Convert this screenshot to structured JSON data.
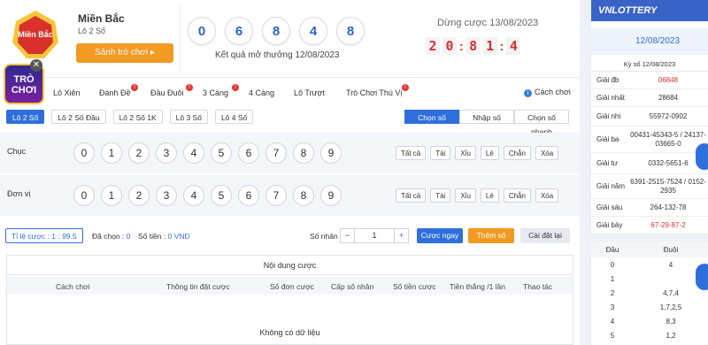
{
  "header": {
    "region_badge": "Miền Bắc",
    "region_title": "Miền Bắc",
    "region_sub": "Lô 2 Số",
    "lobby_button": "Sảnh trò chơi ▸",
    "result_balls": [
      "0",
      "6",
      "8",
      "4",
      "8"
    ],
    "result_caption": "Kết quả mở thưởng 12/08/2023",
    "stop_label": "Dừng cược 13/08/2023",
    "timer": [
      "2",
      "0",
      "8",
      "1",
      "4"
    ],
    "game_badge": "TRÒ CHƠI",
    "close": "✕"
  },
  "tabs": [
    {
      "label": "Lô Xiên",
      "hot": false
    },
    {
      "label": "Đánh Đề",
      "hot": true
    },
    {
      "label": "Đầu Đuôi",
      "hot": true
    },
    {
      "label": "3 Càng",
      "hot": true
    },
    {
      "label": "4 Càng",
      "hot": false
    },
    {
      "label": "Lô Trượt",
      "hot": false
    },
    {
      "label": "Trò Chơi Thú Vị",
      "hot": true
    }
  ],
  "how_to_play": "Cách chơi",
  "subtabs": [
    "Lô 2 Số",
    "Lô 2 Số Đầu",
    "Lô 2 Số 1K",
    "Lô 3 Số",
    "Lô 4 Số"
  ],
  "modes": [
    "Chọn số",
    "Nhập số",
    "Chọn số nhanh"
  ],
  "rows": [
    {
      "label": "Chục"
    },
    {
      "label": "Đơn vị"
    }
  ],
  "numbers": [
    "0",
    "1",
    "2",
    "3",
    "4",
    "5",
    "6",
    "7",
    "8",
    "9"
  ],
  "ops": [
    "Tất cả",
    "Tài",
    "Xỉu",
    "Lẻ",
    "Chẵn",
    "Xóa"
  ],
  "bet": {
    "rate": "Tỉ lệ cược : 1 : 99.5",
    "selected_label": "Đã chọn :",
    "selected_value": "0",
    "money_label": "Số tiền :",
    "money_value": "0 VND",
    "multiplier_label": "Số nhân :",
    "multiplier_value": "1",
    "minus": "−",
    "plus": "+",
    "bet_now": "Cược ngay",
    "add_number": "Thêm số",
    "reset": "Cài đặt lại"
  },
  "table": {
    "title": "Nội dung cược",
    "headers": [
      "Cách chơi",
      "Thông tin đặt cược",
      "Số đơn cược",
      "Cấp số nhân",
      "Số tiền cược",
      "Tiền thắng /1 lần",
      "Thao tác"
    ],
    "empty": "Không có dữ liệu"
  },
  "sidebar": {
    "logo": "VNLOTTERY",
    "date": "12/08/2023",
    "ky_so": "Kỳ số 12/08/2023",
    "prizes": [
      {
        "name": "Giải đb",
        "value": "06848"
      },
      {
        "name": "Giải nhất",
        "value": "28684"
      },
      {
        "name": "Giải nhì",
        "value": "55972-0902"
      },
      {
        "name": "Giải ba",
        "value": "00431-45343-5 / 24137-03665-0"
      },
      {
        "name": "Giải tư",
        "value": "0332-5651-6"
      },
      {
        "name": "Giải năm",
        "value": "6391-2515-7524 / 0152-2935"
      },
      {
        "name": "Giải sáu",
        "value": "264-132-78"
      },
      {
        "name": "Giải bảy",
        "value": "67-29-87-2"
      }
    ],
    "dau_header": "Đầu",
    "duoi_header": "Đuôi",
    "dau_rows": [
      {
        "dau": "0",
        "duoi": "4"
      },
      {
        "dau": "1",
        "duoi": ""
      },
      {
        "dau": "2",
        "duoi": "4,7,4"
      },
      {
        "dau": "3",
        "duoi": "1,7,2,5"
      },
      {
        "dau": "4",
        "duoi": "8,3"
      },
      {
        "dau": "5",
        "duoi": "1,2"
      }
    ]
  }
}
